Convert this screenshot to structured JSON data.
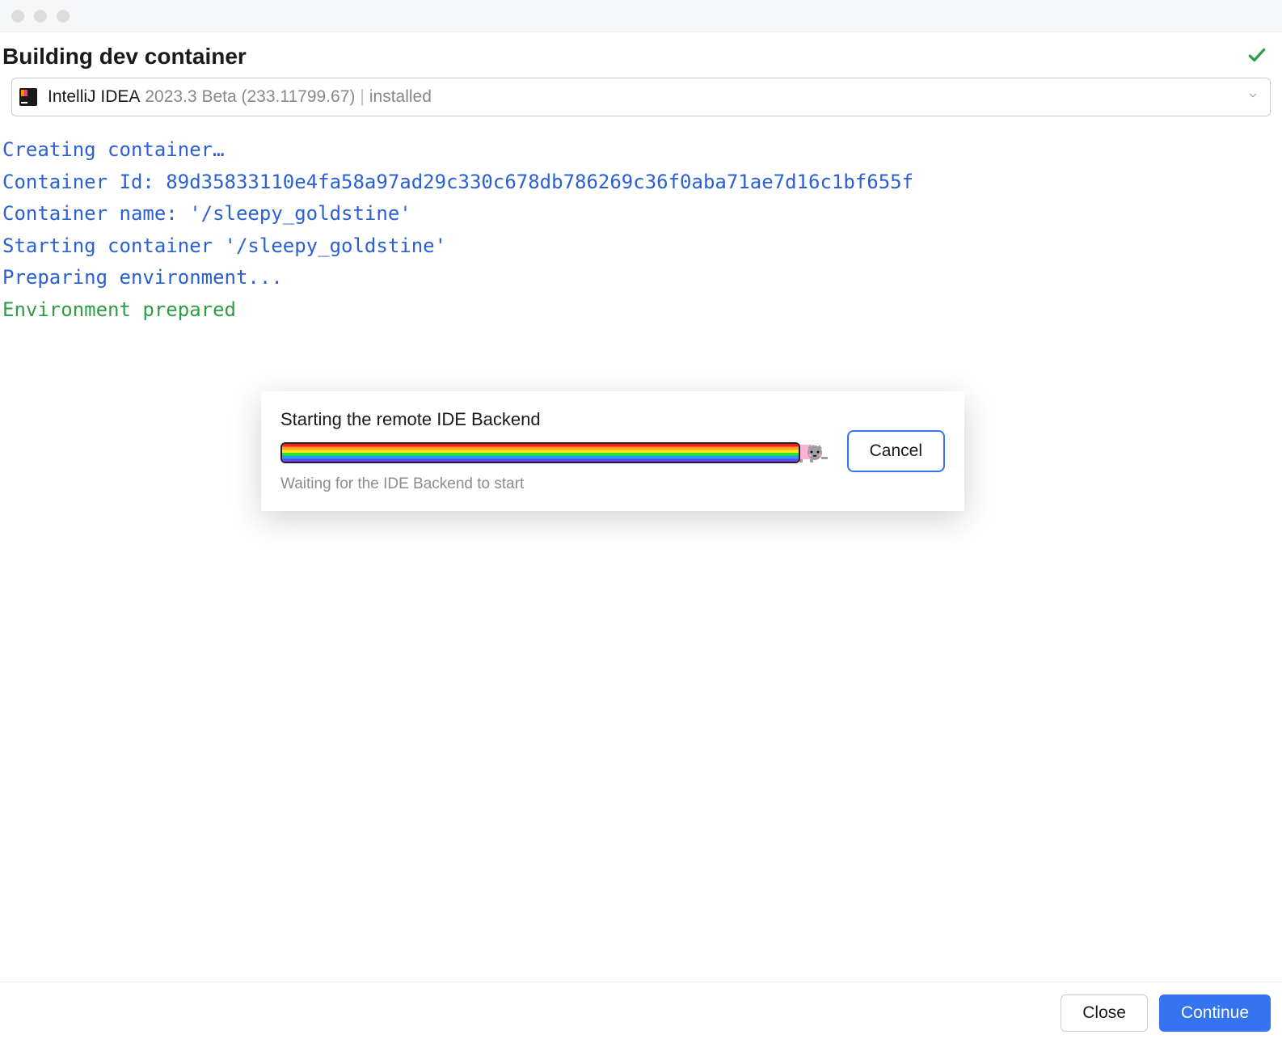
{
  "header": {
    "title": "Building dev container"
  },
  "ide_selector": {
    "name": "IntelliJ IDEA",
    "version": "2023.3 Beta (233.11799.67)",
    "status": "installed"
  },
  "log_lines": [
    {
      "text": "Creating container…",
      "class": "log-info"
    },
    {
      "text": "Container Id: 89d35833110e4fa58a97ad29c330c678db786269c36f0aba71ae7d16c1bf655f",
      "class": "log-info"
    },
    {
      "text": "Container name: '/sleepy_goldstine'",
      "class": "log-info"
    },
    {
      "text": "Starting container '/sleepy_goldstine'",
      "class": "log-info"
    },
    {
      "text": "Preparing environment...",
      "class": "log-info"
    },
    {
      "text": "Environment prepared",
      "class": "log-success"
    }
  ],
  "dialog": {
    "title": "Starting the remote IDE Backend",
    "subtitle": "Waiting for the IDE Backend to start",
    "cancel": "Cancel"
  },
  "footer": {
    "close": "Close",
    "continue": "Continue"
  },
  "colors": {
    "link_blue": "#2a60d4",
    "success_green": "#2e9e46",
    "primary_blue": "#3574f0"
  }
}
